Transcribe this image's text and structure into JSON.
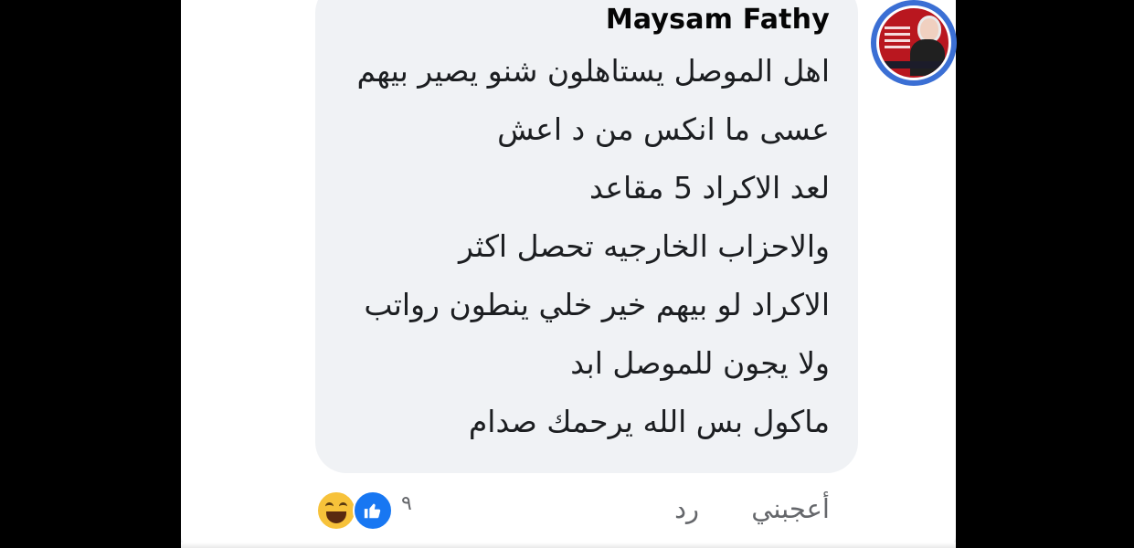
{
  "comment": {
    "author": "Maysam Fathy",
    "lines": [
      "اهل الموصل يستاهلون شنو يصير بيهم",
      "عسى ما انكس من د اعش",
      "لعد الاكراد 5 مقاعد",
      "والاحزاب الخارجيه تحصل اكثر",
      "الاكراد لو بيهم خير خلي ينطون رواتب",
      "ولا يجون للموصل ابد",
      "ماكول بس الله يرحمك صدام"
    ]
  },
  "actions": {
    "like_label": "أعجبني",
    "reply_label": "رد"
  },
  "reactions": {
    "icons": [
      "haha-icon",
      "like-icon"
    ],
    "count": "٩"
  },
  "colors": {
    "bubble": "#f0f2f5",
    "like_blue": "#1877f2",
    "haha_yellow": "#f7c23a",
    "meta_gray": "#65676b"
  }
}
